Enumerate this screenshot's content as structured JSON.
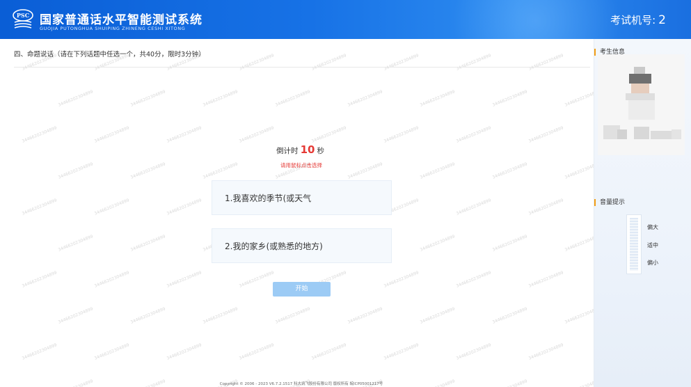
{
  "header": {
    "logo_text": "PSC",
    "title_cn": "国家普通话水平智能测试系统",
    "title_en": "GUOJIA PUTONGHUA SHUIPING ZHINENG CESHI XITONG",
    "machine_label": "考试机号:",
    "machine_number": "2"
  },
  "main": {
    "section_title": "四、命题说话（请在下列话题中任选一个，共40分，限时3分钟）",
    "countdown_prefix": "倒计时",
    "countdown_value": "10",
    "countdown_suffix": "秒",
    "hint": "请用鼠标点击选择",
    "topics": [
      "1.我喜欢的季节(或天气",
      "2.我的家乡(或熟悉的地方)"
    ],
    "start_button": "开始",
    "watermark": "34466202304899",
    "copyright": "Copyright © 2006 - 2023 V6.7.2.1517 科大讯飞股份有限公司 版权所有 皖ICP05001217号"
  },
  "sidebar": {
    "candidate_info_title": "考生信息",
    "volume_title": "音量提示",
    "volume_levels": [
      "偏大",
      "适中",
      "偏小"
    ]
  },
  "colors": {
    "header_blue": "#1772e6",
    "accent_orange": "#f39c12",
    "countdown_red": "#e53935",
    "button_blue": "#9ccbf5"
  }
}
